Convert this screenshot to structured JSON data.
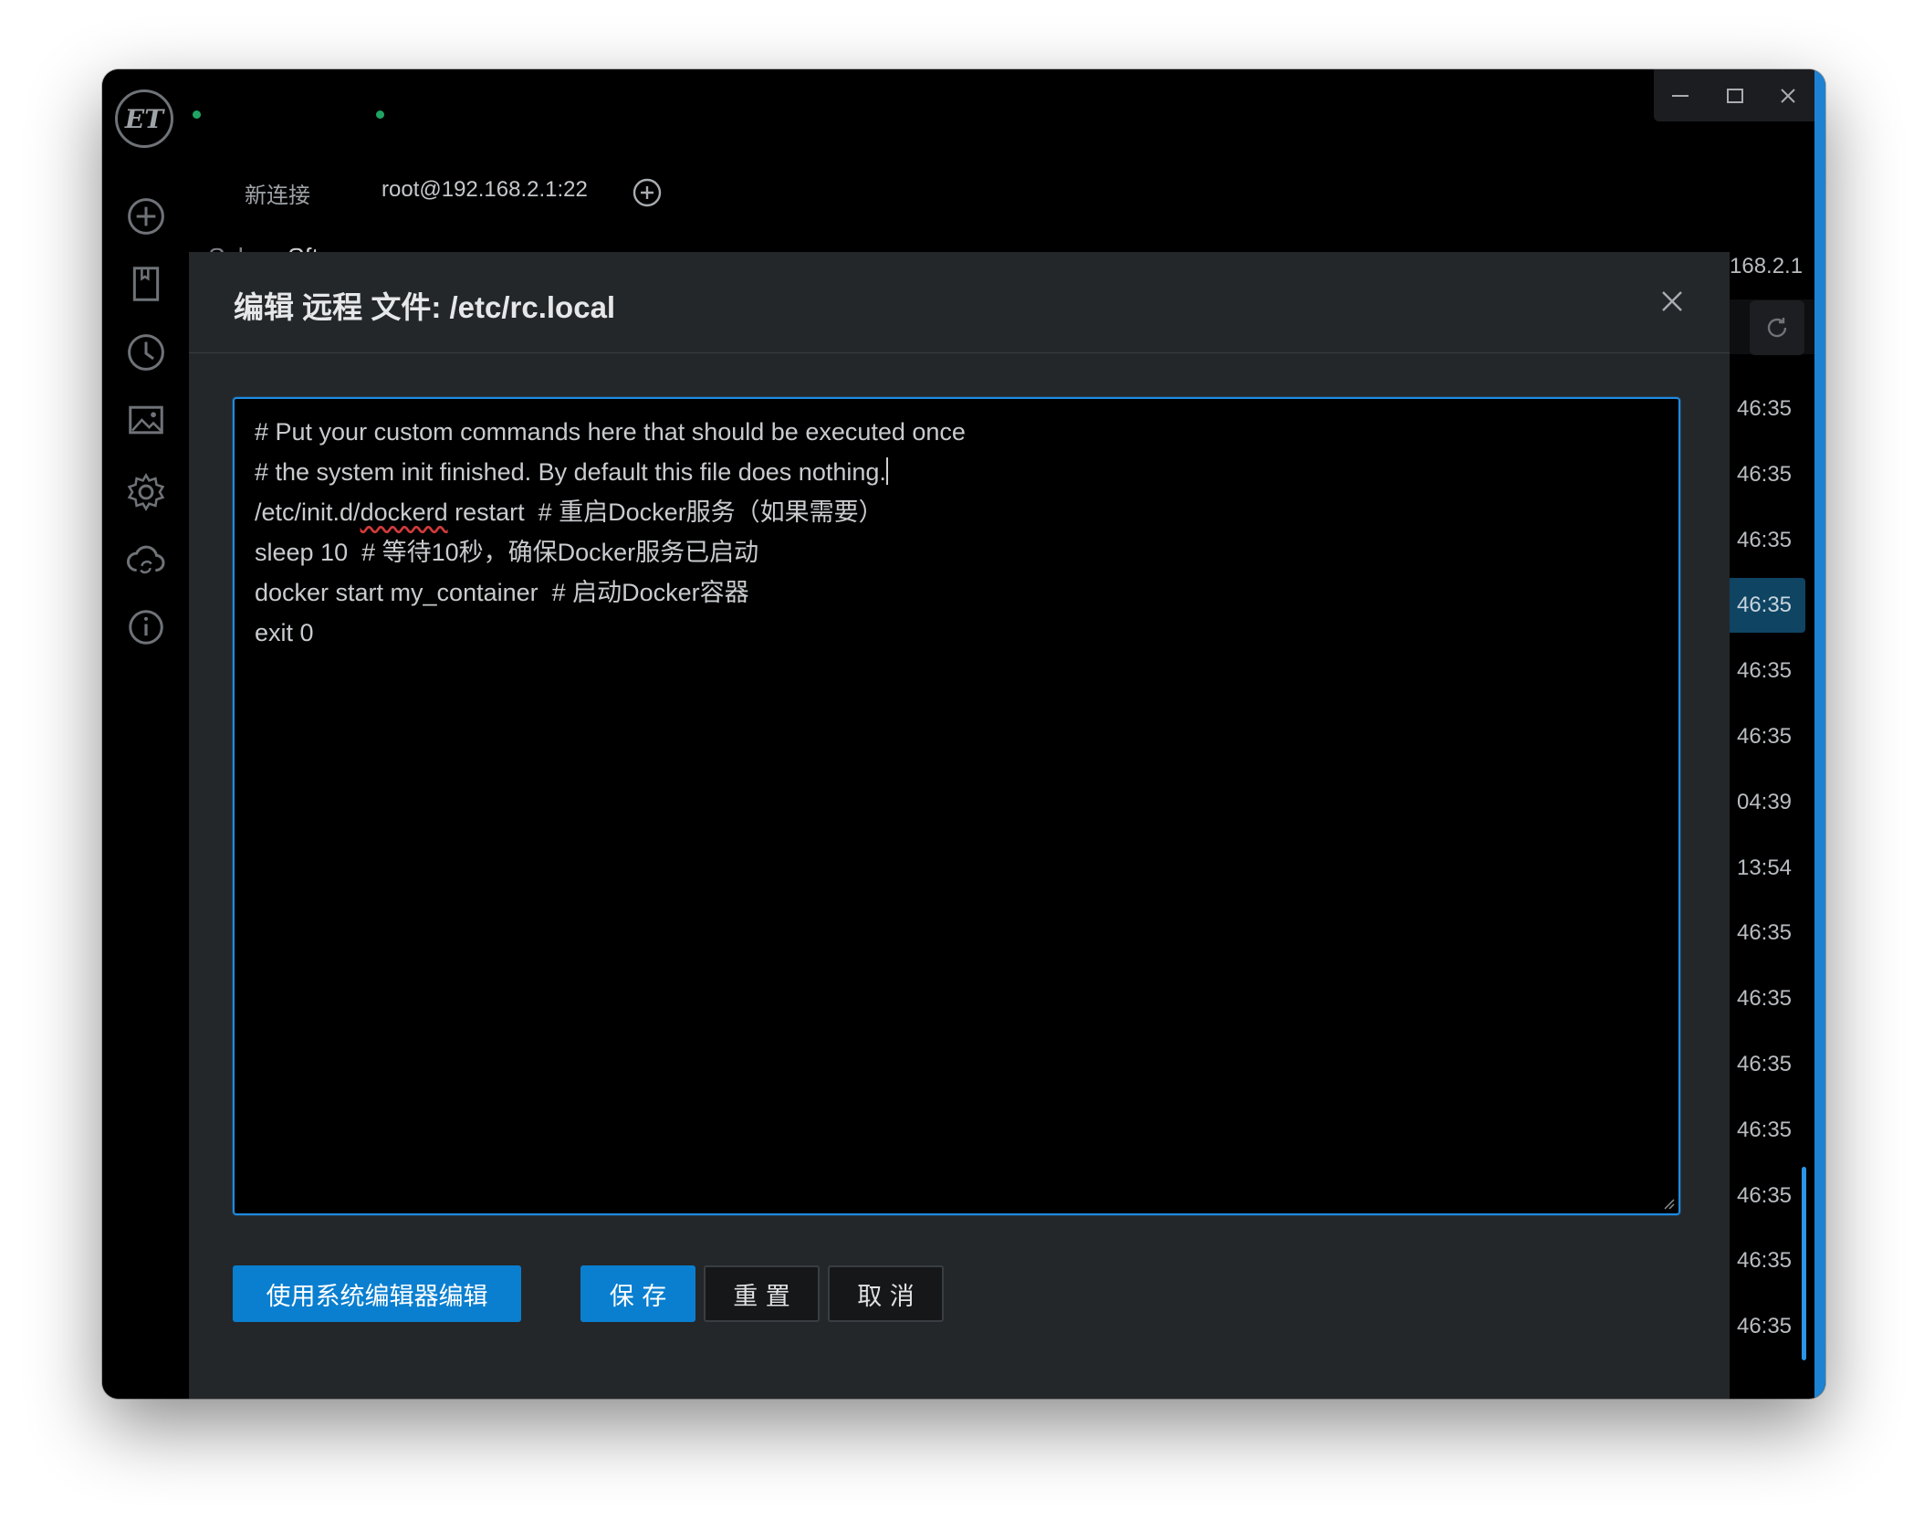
{
  "tabs": [
    {
      "label": "新连接"
    },
    {
      "label": "root@192.168.2.1:22"
    }
  ],
  "subtabs": [
    {
      "label": "Ssh"
    },
    {
      "label": "Sftp"
    }
  ],
  "sidebar": {
    "logo_text": "ET",
    "icons": [
      "add-connection-icon",
      "bookmark-icon",
      "history-clock-icon",
      "image-icon",
      "settings-gear-icon",
      "cloud-sync-icon",
      "info-icon"
    ]
  },
  "window_controls": {
    "minimize": "minimize-icon",
    "maximize": "maximize-icon",
    "close": "close-icon"
  },
  "right_panel": {
    "ip_fragment": "168.2.1",
    "times": [
      "46:35",
      "46:35",
      "46:35",
      "46:35",
      "46:35",
      "46:35",
      "04:39",
      "13:54",
      "46:35",
      "46:35",
      "46:35",
      "46:35",
      "46:35",
      "46:35",
      "46:35"
    ],
    "selected_index": 3
  },
  "modal": {
    "title": "编辑 远程 文件: /etc/rc.local",
    "code_lines": [
      "# Put your custom commands here that should be executed once",
      "# the system init finished. By default this file does nothing.",
      "/etc/init.d/dockerd restart  # 重启Docker服务（如果需要）",
      "sleep 10  # 等待10秒，确保Docker服务已启动",
      "docker start my_container  # 启动Docker容器",
      "exit 0"
    ],
    "buttons": {
      "system_editor": "使用系统编辑器编辑",
      "save": "保 存",
      "reset": "重 置",
      "cancel": "取 消"
    }
  },
  "colors": {
    "accent": "#0a7fd0",
    "editor_border": "#1e8be0",
    "modal_bg": "#24272a",
    "status_dot": "#1fa463"
  }
}
